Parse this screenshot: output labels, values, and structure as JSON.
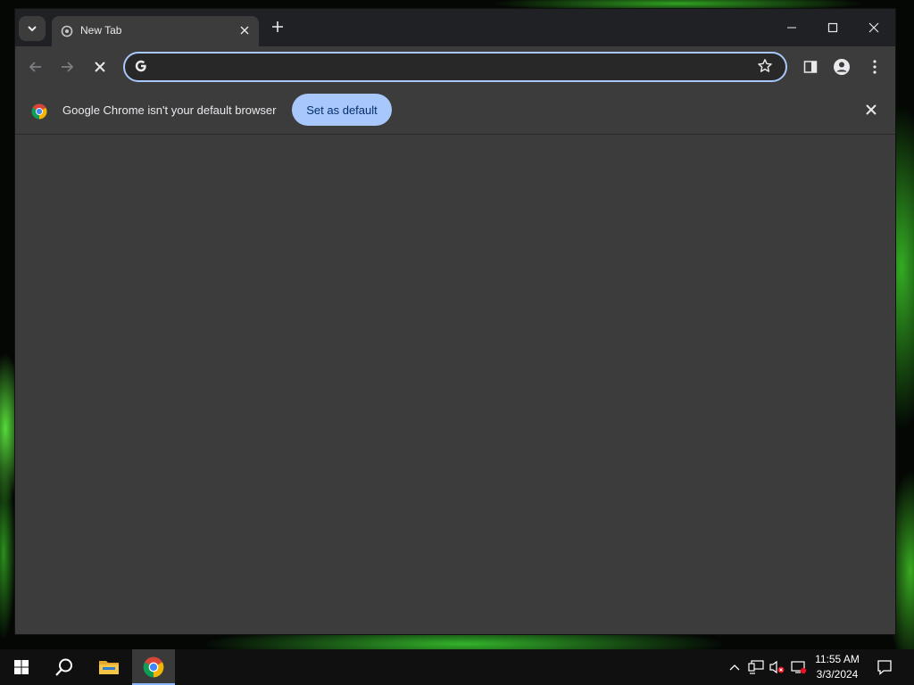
{
  "browser": {
    "tab": {
      "title": "New Tab",
      "close_icon": "close-icon"
    },
    "omnibox": {
      "value": "",
      "placeholder": ""
    },
    "infobar": {
      "message": "Google Chrome isn't your default browser",
      "button_label": "Set as default"
    },
    "accent_color": "#a8c7fa"
  },
  "taskbar": {
    "apps": [
      {
        "name": "start",
        "icon": "windows-logo-icon"
      },
      {
        "name": "search",
        "icon": "search-icon"
      },
      {
        "name": "file-explorer",
        "icon": "folder-icon"
      },
      {
        "name": "chrome",
        "icon": "chrome-icon",
        "active": true
      }
    ],
    "clock": {
      "time": "11:55 AM",
      "date": "3/3/2024"
    }
  }
}
